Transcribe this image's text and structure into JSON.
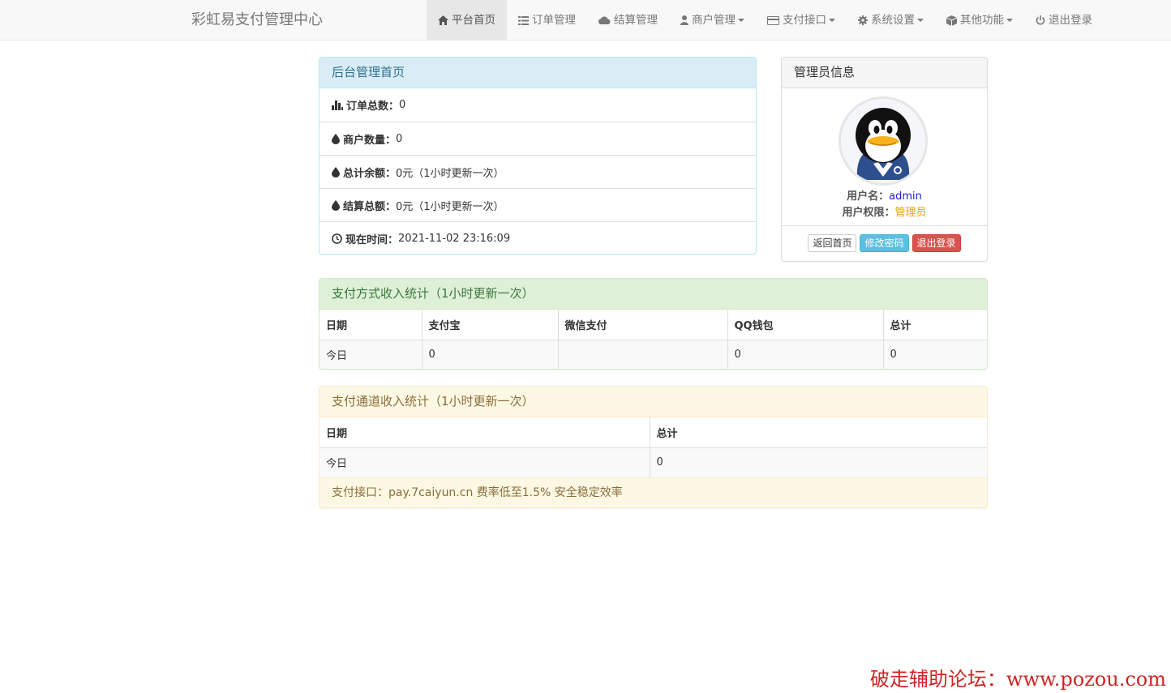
{
  "navbar": {
    "brand": "彩虹易支付管理中心",
    "items": [
      {
        "label": "平台首页"
      },
      {
        "label": "订单管理"
      },
      {
        "label": "结算管理"
      },
      {
        "label": "商户管理"
      },
      {
        "label": "支付接口"
      },
      {
        "label": "系统设置"
      },
      {
        "label": "其他功能"
      },
      {
        "label": "退出登录"
      }
    ]
  },
  "overview": {
    "title": "后台管理首页",
    "items": [
      {
        "label": "订单总数：",
        "value": "0"
      },
      {
        "label": "商户数量：",
        "value": "0"
      },
      {
        "label": "总计余额：",
        "value": "0元（1小时更新一次）"
      },
      {
        "label": "结算总额：",
        "value": "0元（1小时更新一次）"
      },
      {
        "label": "现在时间：",
        "value": " 2021-11-02 23:16:09"
      }
    ]
  },
  "admin": {
    "title": "管理员信息",
    "username_label": "用户名：",
    "username": "admin",
    "role_label": "用户权限：",
    "role": "管理员",
    "buttons": {
      "home": "返回首页",
      "password": "修改密码",
      "logout": "退出登录"
    }
  },
  "pay_stats": {
    "title": "支付方式收入统计（1小时更新一次）",
    "headers": [
      "日期",
      "支付宝",
      "微信支付",
      "QQ钱包",
      "总计"
    ],
    "row": [
      "今日",
      "0",
      "",
      "0",
      "0"
    ]
  },
  "channel_stats": {
    "title": "支付通道收入统计（1小时更新一次）",
    "headers": [
      "日期",
      "总计"
    ],
    "row": [
      "今日",
      "0"
    ],
    "footer": "支付接口：pay.7caiyun.cn 费率低至1.5% 安全稳定效率"
  },
  "watermark": "破走辅助论坛：www.pozou.com",
  "colors": {
    "info": "#d9edf7",
    "success": "#dff0d8",
    "warning": "#fcf8e3",
    "danger": "#d9534f",
    "accent_info": "#5bc0de"
  }
}
